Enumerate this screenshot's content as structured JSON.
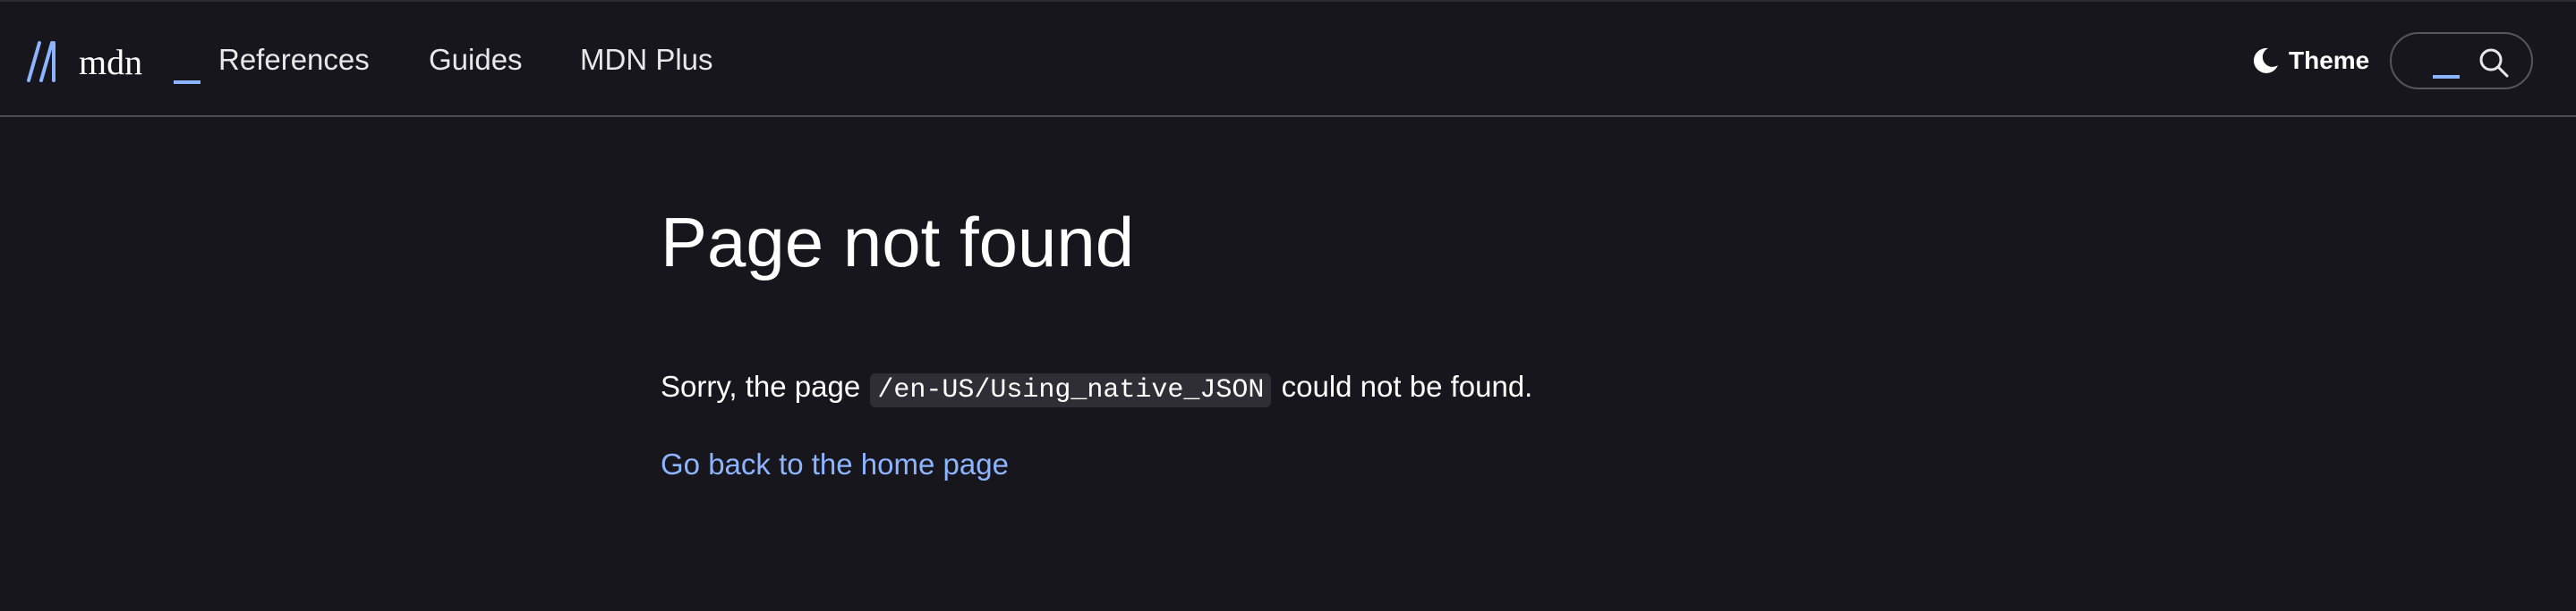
{
  "header": {
    "logo": {
      "text": "mdn",
      "icon": "mdn-logo-icon",
      "accent_color": "#8cb4ff"
    },
    "nav": [
      {
        "label": "References"
      },
      {
        "label": "Guides"
      },
      {
        "label": "MDN Plus"
      }
    ],
    "theme": {
      "label": "Theme",
      "icon": "moon-icon"
    },
    "search": {
      "icon": "search-icon"
    }
  },
  "main": {
    "title": "Page not found",
    "message_before": "Sorry, the page",
    "path": "/en-US/Using_native_JSON",
    "message_after": "could not be found.",
    "home_link": "Go back to the home page"
  },
  "colors": {
    "background": "#17161c",
    "link": "#8cb4ff",
    "code_background": "#2e2e34"
  }
}
